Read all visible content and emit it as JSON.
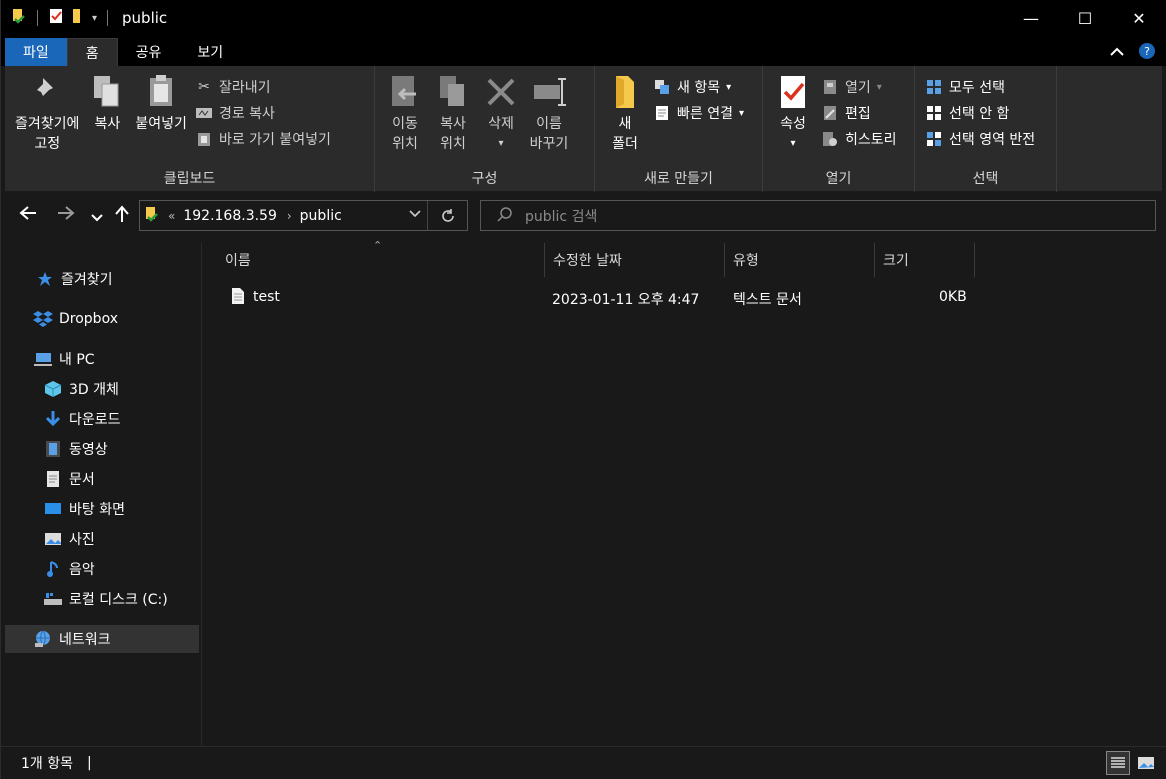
{
  "window": {
    "title": "public",
    "controls": {
      "minimize": "—",
      "maximize": "☐",
      "close": "✕"
    }
  },
  "ribbon_tabs": [
    {
      "label": "파일"
    },
    {
      "label": "홈"
    },
    {
      "label": "공유"
    },
    {
      "label": "보기"
    }
  ],
  "ribbon": {
    "clipboard": {
      "label": "클립보드",
      "pin_line1": "즐겨찾기에",
      "pin_line2": "고정",
      "copy": "복사",
      "paste": "붙여넣기",
      "cut": "잘라내기",
      "copy_path": "경로 복사",
      "paste_shortcut": "바로 가기 붙여넣기"
    },
    "organize": {
      "label": "구성",
      "move_line1": "이동",
      "move_line2": "위치",
      "copyto_line1": "복사",
      "copyto_line2": "위치",
      "delete": "삭제",
      "rename_line1": "이름",
      "rename_line2": "바꾸기"
    },
    "new": {
      "label": "새로 만들기",
      "folder_line1": "새",
      "folder_line2": "폴더",
      "new_item": "새 항목",
      "easy_access": "빠른 연결"
    },
    "open": {
      "label": "열기",
      "properties": "속성",
      "open": "열기",
      "edit": "편집",
      "history": "히스토리"
    },
    "select": {
      "label": "선택",
      "select_all": "모두 선택",
      "select_none": "선택 안 함",
      "invert": "선택 영역 반전"
    }
  },
  "address": {
    "overflow": "«",
    "crumbs": [
      "192.168.3.59",
      "public"
    ],
    "search_placeholder": "public 검색"
  },
  "sidebar": {
    "items": [
      {
        "label": "즐겨찾기",
        "icon": "star-icon"
      },
      {
        "label": "Dropbox",
        "icon": "dropbox-icon"
      },
      {
        "label": "내 PC",
        "icon": "computer-icon"
      },
      {
        "label": "3D 개체",
        "icon": "cube-icon"
      },
      {
        "label": "다운로드",
        "icon": "download-icon"
      },
      {
        "label": "동영상",
        "icon": "video-icon"
      },
      {
        "label": "문서",
        "icon": "document-icon"
      },
      {
        "label": "바탕 화면",
        "icon": "desktop-icon"
      },
      {
        "label": "사진",
        "icon": "pictures-icon"
      },
      {
        "label": "음악",
        "icon": "music-icon"
      },
      {
        "label": "로컬 디스크 (C:)",
        "icon": "drive-icon"
      },
      {
        "label": "네트워크",
        "icon": "network-icon"
      }
    ]
  },
  "file_list": {
    "columns": [
      "이름",
      "수정한 날짜",
      "유형",
      "크기"
    ],
    "rows": [
      {
        "name": "test",
        "modified": "2023-01-11 오후 4:47",
        "type": "텍스트 문서",
        "size": "0KB"
      }
    ]
  },
  "status": {
    "count": "1개 항목",
    "separator": "|"
  },
  "colors": {
    "accent": "#1a66b8",
    "background": "#191919",
    "ribbon": "#2b2b2b"
  }
}
